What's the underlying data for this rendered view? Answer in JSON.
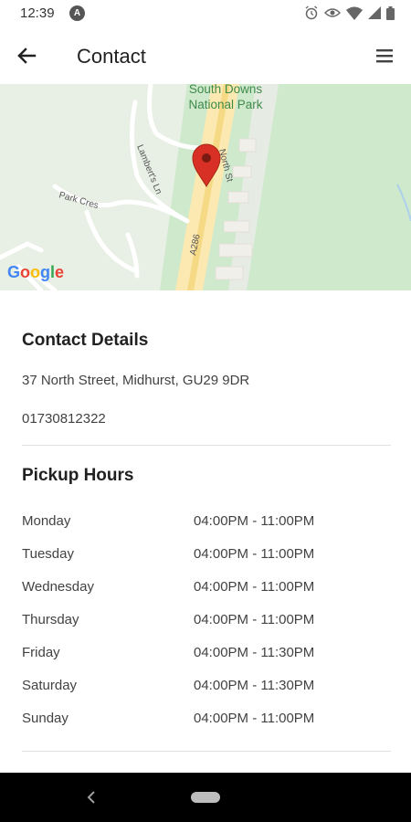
{
  "status_bar": {
    "time": "12:39",
    "badge_letter": "A",
    "icons": [
      "alarm-icon",
      "eye-icon",
      "wifi-icon",
      "signal-icon",
      "battery-icon"
    ]
  },
  "app_bar": {
    "title": "Contact",
    "back_icon": "arrow-left-icon",
    "menu_icon": "hamburger-menu-icon"
  },
  "map": {
    "labels": {
      "park_line1": "South Downs",
      "park_line2": "National Park",
      "street_north": "North St",
      "street_lambert": "Lambert's Ln",
      "street_park": "Park Cres",
      "road_code": "A286"
    },
    "provider": "Google",
    "marker_color": "#d93025"
  },
  "contact": {
    "title": "Contact Details",
    "address": "37 North Street, Midhurst, GU29 9DR",
    "phone": "01730812322"
  },
  "pickup": {
    "title": "Pickup Hours",
    "hours": [
      {
        "day": "Monday",
        "time": "04:00PM - 11:00PM"
      },
      {
        "day": "Tuesday",
        "time": "04:00PM - 11:00PM"
      },
      {
        "day": "Wednesday",
        "time": "04:00PM - 11:00PM"
      },
      {
        "day": "Thursday",
        "time": "04:00PM - 11:00PM"
      },
      {
        "day": "Friday",
        "time": "04:00PM - 11:30PM"
      },
      {
        "day": "Saturday",
        "time": "04:00PM - 11:30PM"
      },
      {
        "day": "Sunday",
        "time": "04:00PM - 11:00PM"
      }
    ]
  },
  "nav_bar": {
    "back_icon": "nav-back-icon",
    "home_icon": "nav-home-pill"
  }
}
